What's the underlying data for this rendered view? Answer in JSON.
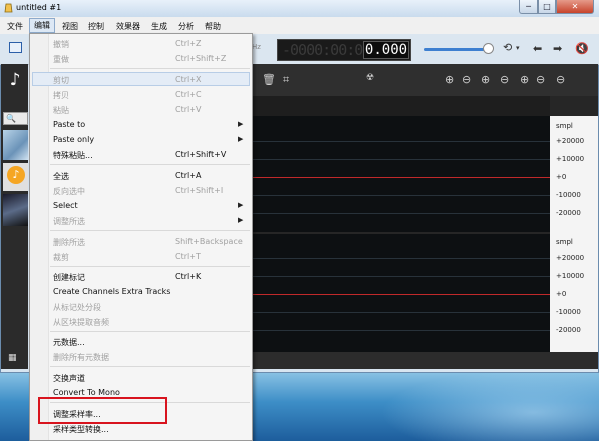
{
  "window": {
    "title": "untitled #1"
  },
  "caption_buttons": {
    "minimize": "─",
    "maximize": "□",
    "close": "✕"
  },
  "menubar": [
    "文件",
    "编辑",
    "视图",
    "控制",
    "效果器",
    "生成",
    "分析",
    "帮助"
  ],
  "toolbar": {
    "hz_label": "Hz",
    "timecode_dim": "-0000:00:0",
    "timecode_value": "0.000"
  },
  "left_panel": {
    "search_icon": "🔍",
    "music_note": "♪",
    "grid_icon": "▦"
  },
  "scale": {
    "unit": "smpl",
    "track1": [
      "smpl",
      "+20000",
      "+10000",
      "+0",
      "-10000",
      "-20000"
    ],
    "track2": [
      "smpl",
      "+20000",
      "+10000",
      "+0",
      "-10000",
      "-20000"
    ]
  },
  "edit_menu": [
    {
      "label": "撤销",
      "shortcut": "Ctrl+Z",
      "disabled": true
    },
    {
      "label": "重做",
      "shortcut": "Ctrl+Shift+Z",
      "disabled": true
    },
    {
      "label": "剪切",
      "shortcut": "Ctrl+X",
      "disabled": true,
      "highlighted": true
    },
    {
      "label": "拷贝",
      "shortcut": "Ctrl+C",
      "disabled": true
    },
    {
      "label": "粘贴",
      "shortcut": "Ctrl+V",
      "disabled": true
    },
    {
      "label": "Paste to",
      "shortcut": "",
      "submenu": true
    },
    {
      "label": "Paste only",
      "shortcut": "",
      "submenu": true
    },
    {
      "label": "特殊粘贴...",
      "shortcut": "Ctrl+Shift+V"
    },
    {
      "label": "全选",
      "shortcut": "Ctrl+A"
    },
    {
      "label": "反向选中",
      "shortcut": "Ctrl+Shift+I",
      "disabled": true
    },
    {
      "label": "Select",
      "shortcut": "",
      "submenu": true
    },
    {
      "label": "调整所选",
      "shortcut": "",
      "submenu": true,
      "disabled": true
    },
    {
      "label": "删除所选",
      "shortcut": "Shift+Backspace",
      "disabled": true
    },
    {
      "label": "裁剪",
      "shortcut": "Ctrl+T",
      "disabled": true
    },
    {
      "label": "创建标记",
      "shortcut": "Ctrl+K"
    },
    {
      "label": "Create Channels Extra Tracks",
      "shortcut": ""
    },
    {
      "label": "从标记处分段",
      "shortcut": "",
      "disabled": true
    },
    {
      "label": "从区块提取音频",
      "shortcut": "",
      "disabled": true
    },
    {
      "label": "元数据...",
      "shortcut": ""
    },
    {
      "label": "删除所有元数据",
      "shortcut": "",
      "disabled": true
    },
    {
      "label": "交换声道",
      "shortcut": ""
    },
    {
      "label": "Convert To Mono",
      "shortcut": ""
    },
    {
      "label": "调整采样率...",
      "shortcut": ""
    },
    {
      "label": "采样类型转换...",
      "shortcut": ""
    }
  ]
}
